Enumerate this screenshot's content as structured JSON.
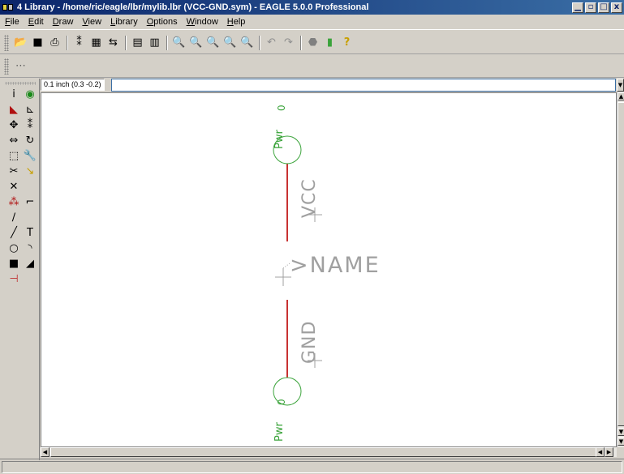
{
  "window": {
    "title": "4 Library - /home/ric/eagle/lbr/mylib.lbr (VCC-GND.sym) - EAGLE 5.0.0 Professional",
    "buttons": {
      "minimize": "▁",
      "restore": "▫",
      "maximize": "□",
      "close": "x"
    }
  },
  "menu": [
    "File",
    "Edit",
    "Draw",
    "View",
    "Library",
    "Options",
    "Window",
    "Help"
  ],
  "toolbar": {
    "items": [
      {
        "name": "open-icon",
        "glyph": "📂"
      },
      {
        "name": "save-icon",
        "glyph": "■"
      },
      {
        "name": "print-icon",
        "glyph": "⎙"
      },
      {
        "name": "sep"
      },
      {
        "name": "cam-icon",
        "glyph": "⁑"
      },
      {
        "name": "library-icon",
        "glyph": "▦"
      },
      {
        "name": "undo-device-icon",
        "glyph": "⇆"
      },
      {
        "name": "sep"
      },
      {
        "name": "script-icon",
        "glyph": "▤"
      },
      {
        "name": "ulp-icon",
        "glyph": "▥"
      },
      {
        "name": "sep"
      },
      {
        "name": "zoom-fit-icon",
        "glyph": "🔍"
      },
      {
        "name": "zoom-in-icon",
        "glyph": "🔍"
      },
      {
        "name": "zoom-out-icon",
        "glyph": "🔍"
      },
      {
        "name": "zoom-redraw-icon",
        "glyph": "🔍"
      },
      {
        "name": "zoom-select-icon",
        "glyph": "🔍"
      },
      {
        "name": "sep"
      },
      {
        "name": "undo-icon",
        "glyph": "↶"
      },
      {
        "name": "redo-icon",
        "glyph": "↷"
      },
      {
        "name": "sep"
      },
      {
        "name": "stop-icon",
        "glyph": "⬣"
      },
      {
        "name": "go-icon",
        "glyph": "▮"
      },
      {
        "name": "help-icon",
        "glyph": "?"
      }
    ]
  },
  "toolbar2": {
    "grid-icon": "⋯"
  },
  "coordinate": "0.1 inch (0.3 -0.2)",
  "command_input": "",
  "palette": [
    {
      "col": 1,
      "row": 0,
      "name": "info-icon",
      "glyph": "i",
      "color": "#000000"
    },
    {
      "col": 2,
      "row": 0,
      "name": "show-icon",
      "glyph": "◉",
      "color": "#1a8a1a"
    },
    {
      "col": 1,
      "row": 1,
      "name": "display-icon",
      "glyph": "◣",
      "color": "#b01010"
    },
    {
      "col": 2,
      "row": 1,
      "name": "mark-icon",
      "glyph": "⊾",
      "color": "#000000"
    },
    {
      "col": 1,
      "row": 2,
      "name": "move-icon",
      "glyph": "✥",
      "color": "#000000"
    },
    {
      "col": 2,
      "row": 2,
      "name": "copy-icon",
      "glyph": "⁑",
      "color": "#000000"
    },
    {
      "col": 1,
      "row": 3,
      "name": "mirror-icon",
      "glyph": "⇔",
      "color": "#000000"
    },
    {
      "col": 2,
      "row": 3,
      "name": "rotate-icon",
      "glyph": "↻",
      "color": "#000000"
    },
    {
      "col": 1,
      "row": 4,
      "name": "group-icon",
      "glyph": "⬚",
      "color": "#000000"
    },
    {
      "col": 2,
      "row": 4,
      "name": "change-icon",
      "glyph": "🔧",
      "color": "#000000"
    },
    {
      "col": 1,
      "row": 5,
      "name": "cut-icon",
      "glyph": "✂",
      "color": "#000000"
    },
    {
      "col": 2,
      "row": 5,
      "name": "paste-icon",
      "glyph": "↘",
      "color": "#c8a000"
    },
    {
      "col": 1,
      "row": 6,
      "name": "delete-icon",
      "glyph": "✕",
      "color": "#000000"
    },
    {
      "col": 1,
      "row": 7,
      "name": "name-icon",
      "glyph": "⁂",
      "color": "#b01010"
    },
    {
      "col": 2,
      "row": 7,
      "name": "miter-icon",
      "glyph": "⌐",
      "color": "#000000"
    },
    {
      "col": 1,
      "row": 8,
      "name": "split-icon",
      "glyph": "∕",
      "color": "#000000"
    },
    {
      "col": 1,
      "row": 9,
      "name": "wire-icon",
      "glyph": "╱",
      "color": "#000000"
    },
    {
      "col": 2,
      "row": 9,
      "name": "text-icon",
      "glyph": "T",
      "color": "#000000"
    },
    {
      "col": 1,
      "row": 10,
      "name": "circle-icon",
      "glyph": "○",
      "color": "#000000"
    },
    {
      "col": 2,
      "row": 10,
      "name": "arc-icon",
      "glyph": "◝",
      "color": "#000000"
    },
    {
      "col": 1,
      "row": 11,
      "name": "rect-icon",
      "glyph": "■",
      "color": "#000000"
    },
    {
      "col": 2,
      "row": 11,
      "name": "polygon-icon",
      "glyph": "◢",
      "color": "#000000"
    },
    {
      "col": 1,
      "row": 12,
      "name": "pin-icon",
      "glyph": "⊣",
      "color": "#c03030"
    }
  ],
  "symbol": {
    "name_label": ">NAME",
    "pin_top_name": "VCC",
    "pin_bottom_name": "GND",
    "pin_top_direction": "Pwr",
    "pin_bottom_direction": "Pwr",
    "pin_top_swap": "0",
    "pin_bottom_swap": "0",
    "colors": {
      "pin": "#c83232",
      "text": "#a0a0a0",
      "green": "#3aa33a"
    }
  },
  "statusbar": {
    "text": ""
  }
}
